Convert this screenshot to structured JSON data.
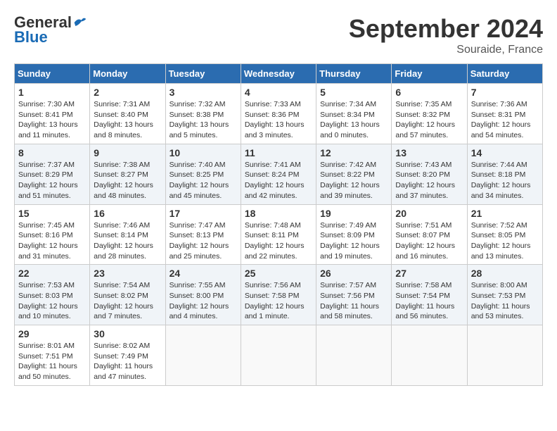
{
  "header": {
    "logo_general": "General",
    "logo_blue": "Blue",
    "month_title": "September 2024",
    "location": "Souraide, France"
  },
  "weekdays": [
    "Sunday",
    "Monday",
    "Tuesday",
    "Wednesday",
    "Thursday",
    "Friday",
    "Saturday"
  ],
  "weeks": [
    [
      {
        "day": "1",
        "sunrise": "7:30 AM",
        "sunset": "8:41 PM",
        "daylight": "13 hours and 11 minutes."
      },
      {
        "day": "2",
        "sunrise": "7:31 AM",
        "sunset": "8:40 PM",
        "daylight": "13 hours and 8 minutes."
      },
      {
        "day": "3",
        "sunrise": "7:32 AM",
        "sunset": "8:38 PM",
        "daylight": "13 hours and 5 minutes."
      },
      {
        "day": "4",
        "sunrise": "7:33 AM",
        "sunset": "8:36 PM",
        "daylight": "13 hours and 3 minutes."
      },
      {
        "day": "5",
        "sunrise": "7:34 AM",
        "sunset": "8:34 PM",
        "daylight": "13 hours and 0 minutes."
      },
      {
        "day": "6",
        "sunrise": "7:35 AM",
        "sunset": "8:32 PM",
        "daylight": "12 hours and 57 minutes."
      },
      {
        "day": "7",
        "sunrise": "7:36 AM",
        "sunset": "8:31 PM",
        "daylight": "12 hours and 54 minutes."
      }
    ],
    [
      {
        "day": "8",
        "sunrise": "7:37 AM",
        "sunset": "8:29 PM",
        "daylight": "12 hours and 51 minutes."
      },
      {
        "day": "9",
        "sunrise": "7:38 AM",
        "sunset": "8:27 PM",
        "daylight": "12 hours and 48 minutes."
      },
      {
        "day": "10",
        "sunrise": "7:40 AM",
        "sunset": "8:25 PM",
        "daylight": "12 hours and 45 minutes."
      },
      {
        "day": "11",
        "sunrise": "7:41 AM",
        "sunset": "8:24 PM",
        "daylight": "12 hours and 42 minutes."
      },
      {
        "day": "12",
        "sunrise": "7:42 AM",
        "sunset": "8:22 PM",
        "daylight": "12 hours and 39 minutes."
      },
      {
        "day": "13",
        "sunrise": "7:43 AM",
        "sunset": "8:20 PM",
        "daylight": "12 hours and 37 minutes."
      },
      {
        "day": "14",
        "sunrise": "7:44 AM",
        "sunset": "8:18 PM",
        "daylight": "12 hours and 34 minutes."
      }
    ],
    [
      {
        "day": "15",
        "sunrise": "7:45 AM",
        "sunset": "8:16 PM",
        "daylight": "12 hours and 31 minutes."
      },
      {
        "day": "16",
        "sunrise": "7:46 AM",
        "sunset": "8:14 PM",
        "daylight": "12 hours and 28 minutes."
      },
      {
        "day": "17",
        "sunrise": "7:47 AM",
        "sunset": "8:13 PM",
        "daylight": "12 hours and 25 minutes."
      },
      {
        "day": "18",
        "sunrise": "7:48 AM",
        "sunset": "8:11 PM",
        "daylight": "12 hours and 22 minutes."
      },
      {
        "day": "19",
        "sunrise": "7:49 AM",
        "sunset": "8:09 PM",
        "daylight": "12 hours and 19 minutes."
      },
      {
        "day": "20",
        "sunrise": "7:51 AM",
        "sunset": "8:07 PM",
        "daylight": "12 hours and 16 minutes."
      },
      {
        "day": "21",
        "sunrise": "7:52 AM",
        "sunset": "8:05 PM",
        "daylight": "12 hours and 13 minutes."
      }
    ],
    [
      {
        "day": "22",
        "sunrise": "7:53 AM",
        "sunset": "8:03 PM",
        "daylight": "12 hours and 10 minutes."
      },
      {
        "day": "23",
        "sunrise": "7:54 AM",
        "sunset": "8:02 PM",
        "daylight": "12 hours and 7 minutes."
      },
      {
        "day": "24",
        "sunrise": "7:55 AM",
        "sunset": "8:00 PM",
        "daylight": "12 hours and 4 minutes."
      },
      {
        "day": "25",
        "sunrise": "7:56 AM",
        "sunset": "7:58 PM",
        "daylight": "12 hours and 1 minute."
      },
      {
        "day": "26",
        "sunrise": "7:57 AM",
        "sunset": "7:56 PM",
        "daylight": "11 hours and 58 minutes."
      },
      {
        "day": "27",
        "sunrise": "7:58 AM",
        "sunset": "7:54 PM",
        "daylight": "11 hours and 56 minutes."
      },
      {
        "day": "28",
        "sunrise": "8:00 AM",
        "sunset": "7:53 PM",
        "daylight": "11 hours and 53 minutes."
      }
    ],
    [
      {
        "day": "29",
        "sunrise": "8:01 AM",
        "sunset": "7:51 PM",
        "daylight": "11 hours and 50 minutes."
      },
      {
        "day": "30",
        "sunrise": "8:02 AM",
        "sunset": "7:49 PM",
        "daylight": "11 hours and 47 minutes."
      },
      null,
      null,
      null,
      null,
      null
    ]
  ]
}
